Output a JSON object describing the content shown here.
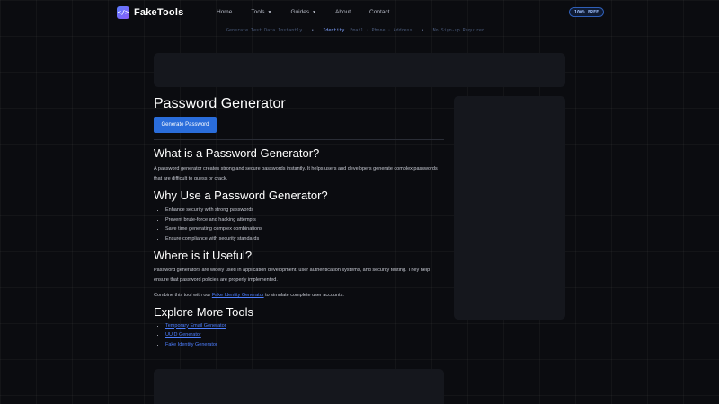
{
  "nav": {
    "brand": "FakeTools",
    "logo_glyph": "</>",
    "links": [
      {
        "label": "Home",
        "has_dropdown": false
      },
      {
        "label": "Tools",
        "has_dropdown": true
      },
      {
        "label": "Guides",
        "has_dropdown": true
      },
      {
        "label": "About",
        "has_dropdown": false
      },
      {
        "label": "Contact",
        "has_dropdown": false
      }
    ],
    "badge": "100% FREE"
  },
  "ticker": {
    "items": [
      "Generate Test Data Instantly",
      "Identity",
      "Email · Phone · Address",
      "No Sign-up Required"
    ]
  },
  "page": {
    "title": "Password Generator",
    "generate_button": "Generate Password",
    "what_heading": "What is a Password Generator?",
    "what_text": "A password generator creates strong and secure passwords instantly. It helps users and developers generate complex passwords that are difficult to guess or crack.",
    "why_heading": "Why Use a Password Generator?",
    "why_items": [
      "Enhance security with strong passwords",
      "Prevent brute-force and hacking attempts",
      "Save time generating complex combinations",
      "Ensure compliance with security standards"
    ],
    "where_heading": "Where is it Useful?",
    "where_text": "Password generators are widely used in application development, user authentication systems, and security testing. They help ensure that password policies are properly implemented.",
    "combine_prefix": "Combine this tool with our ",
    "combine_link": "Fake Identity Generator",
    "combine_suffix": " to simulate complete user accounts.",
    "explore_heading": "Explore More Tools",
    "explore_links": [
      "Temporary Email Generator",
      "UUID Generator",
      "Fake Identity Generator"
    ]
  },
  "colors": {
    "accent": "#2a6ddb",
    "link": "#4d7fff",
    "background": "#0b0c10",
    "panel": "#15171d"
  }
}
